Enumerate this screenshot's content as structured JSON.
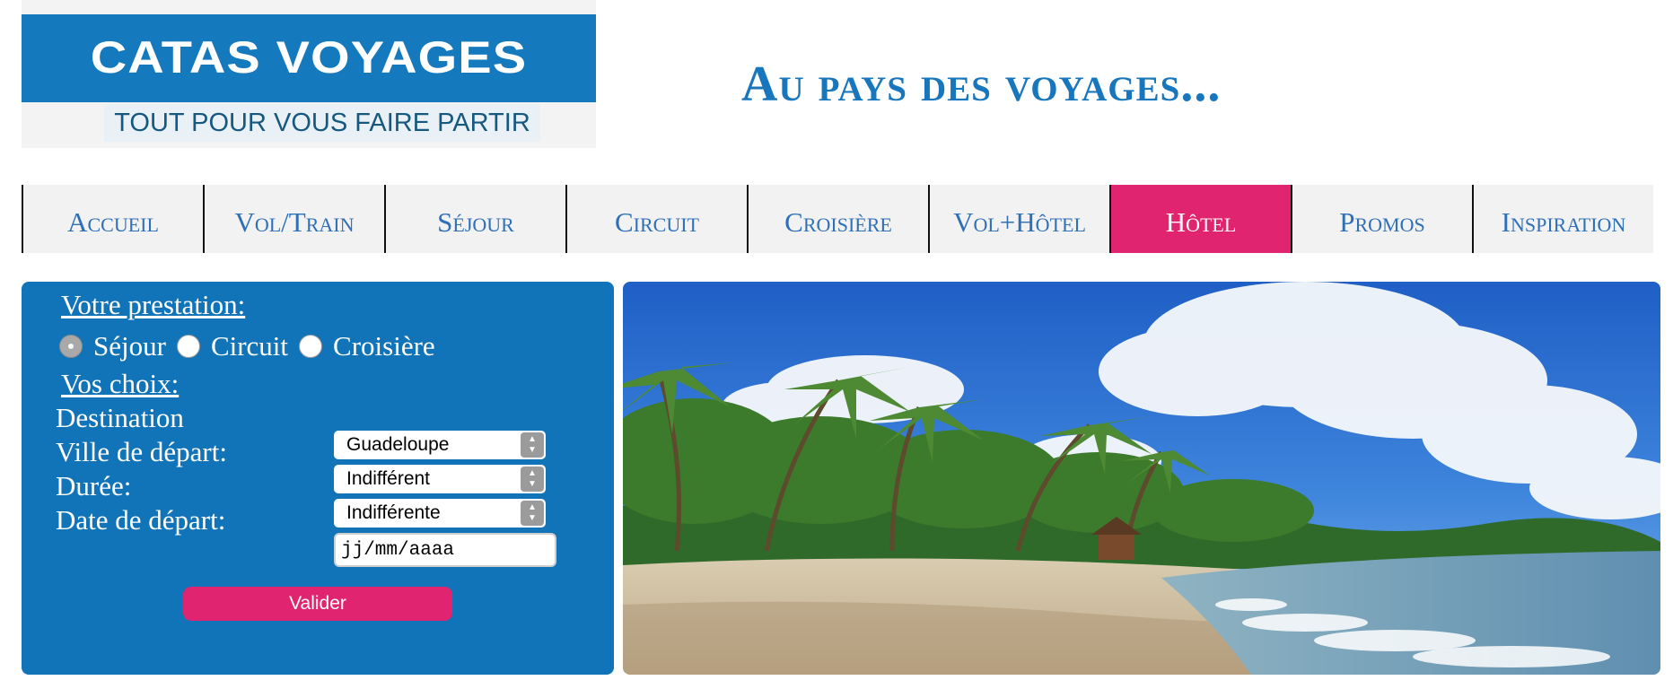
{
  "logo": {
    "title": "CATAS VOYAGES",
    "tagline": "TOUT POUR VOUS FAIRE PARTIR"
  },
  "header": {
    "title": "Au pays des voyages..."
  },
  "nav": {
    "items": [
      {
        "label": "Accueil"
      },
      {
        "label": "Vol/Train"
      },
      {
        "label": "Séjour"
      },
      {
        "label": "Circuit"
      },
      {
        "label": "Croisière"
      },
      {
        "label": "Vol+Hôtel"
      },
      {
        "label": "Hôtel",
        "active": true
      },
      {
        "label": "Promos"
      },
      {
        "label": "Inspiration"
      }
    ]
  },
  "form": {
    "prestation_title": "Votre prestation:",
    "prestations": [
      {
        "label": "Séjour",
        "checked": true
      },
      {
        "label": "Circuit",
        "checked": false
      },
      {
        "label": "Croisière",
        "checked": false
      }
    ],
    "choices_title": "Vos choix:",
    "destination": {
      "label": "Destination",
      "value": "Guadeloupe"
    },
    "departure_city": {
      "label": "Ville de départ:",
      "value": "Indifférent"
    },
    "duration": {
      "label": "Durée:",
      "value": "Indifférente"
    },
    "departure_date": {
      "label": "Date de départ:",
      "placeholder": "jj/mm/aaaa"
    },
    "submit_label": "Valider"
  },
  "colors": {
    "brand_blue": "#1274b8",
    "accent_pink": "#e0246f",
    "nav_background": "#f2f2f2",
    "nav_text": "#2e6fb8"
  },
  "icons": {
    "select_arrows": "chevron-up-down-icon",
    "radio": "radio-circle-icon"
  }
}
